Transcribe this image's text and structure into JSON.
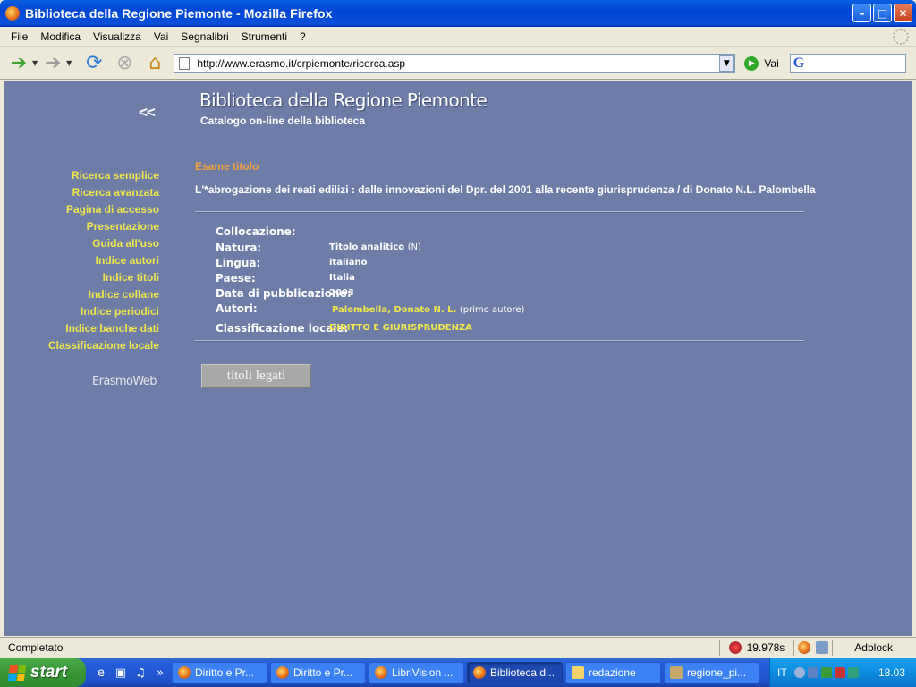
{
  "window": {
    "title": "Biblioteca della Regione Piemonte - Mozilla Firefox"
  },
  "menu": [
    "File",
    "Modifica",
    "Visualizza",
    "Vai",
    "Segnalibri",
    "Strumenti",
    "?"
  ],
  "toolbar": {
    "url": "http://www.erasmo.it/crpiemonte/ricerca.asp",
    "go_label": "Vai",
    "search_engine_glyph": "G"
  },
  "page": {
    "site_title": "Biblioteca della Regione Piemonte",
    "site_subtitle": "Catalogo on-line della biblioteca",
    "back_link": "<<",
    "nav": [
      "Ricerca semplice",
      "Ricerca avanzata",
      "Pagina di accesso",
      "Presentazione",
      "Guida all'uso",
      "Indice autori",
      "Indice titoli",
      "Indice collane",
      "Indice periodici",
      "Indice banche dati",
      "Classificazione locale"
    ],
    "erasmoweb": "ErasmoWeb",
    "section_label": "Esame titolo",
    "record_title": "L'*abrogazione dei reati edilizi : dalle innovazioni del Dpr. del 2001 alla recente giurisprudenza / di Donato N.L. Palombella",
    "fields": {
      "collocazione_label": "Collocazione:",
      "natura_label": "Natura:",
      "natura_value": "Titolo analitico",
      "natura_note": "(N)",
      "lingua_label": "Lingua:",
      "lingua_value": "italiano",
      "paese_label": "Paese:",
      "paese_value": "Italia",
      "data_label": "Data di pubblicazione:",
      "data_value": "2003",
      "autori_label": "Autori:",
      "autori_value": "Palombella, Donato N. L.",
      "autori_note": "(primo autore)",
      "class_label": "Classificazione locale:",
      "class_value": "DIRITTO E GIURISPRUDENZA"
    },
    "related_button": "titoli legati"
  },
  "status": {
    "text": "Completato",
    "timer": "19.978s",
    "adblock": "Adblock"
  },
  "taskbar": {
    "start": "start",
    "tasks": [
      {
        "label": "Diritto e Pr...",
        "icon": "firefox-icon"
      },
      {
        "label": "Diritto e Pr...",
        "icon": "firefox-icon"
      },
      {
        "label": "LibriVision ...",
        "icon": "firefox-icon"
      },
      {
        "label": "Biblioteca d...",
        "icon": "firefox-icon",
        "active": true
      },
      {
        "label": "redazione",
        "icon": "folder-icon"
      },
      {
        "label": "regione_pi...",
        "icon": "file-icon"
      }
    ],
    "lang": "IT",
    "clock": "18.03"
  },
  "colors": {
    "page_bg": "#6D7DA7",
    "nav_link": "#F0E74A",
    "section_label": "#F6A23C"
  }
}
